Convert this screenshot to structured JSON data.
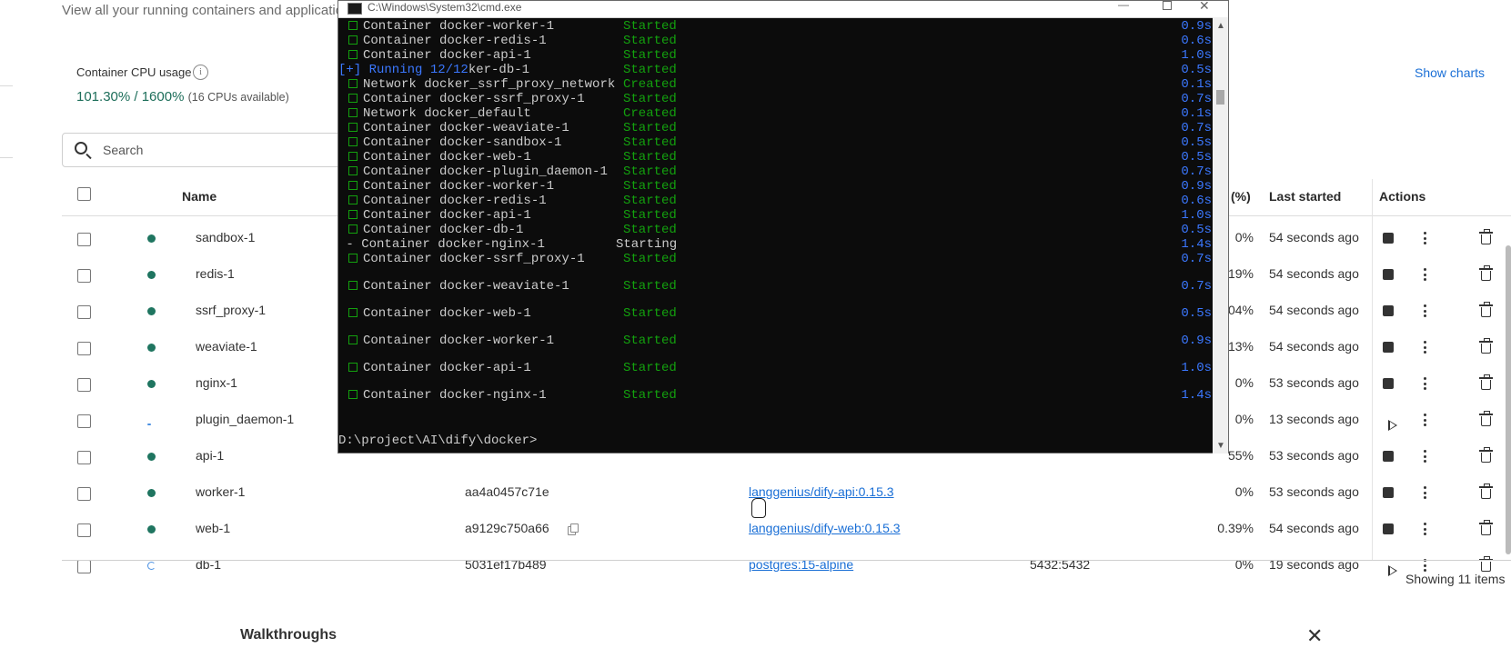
{
  "header": {
    "subtitle": "View all your running containers and applications",
    "cpu_label": "Container CPU usage",
    "info_icon": "info-icon",
    "cpu_value": "101.30% / 1600%",
    "cpu_available": "(16 CPUs available)",
    "show_charts": "Show charts"
  },
  "search": {
    "placeholder": "Search"
  },
  "table": {
    "col_name": "Name",
    "col_cpu": "(%)",
    "col_last_started": "Last started",
    "col_actions": "Actions",
    "rows": [
      {
        "name": "sandbox-1",
        "id": "",
        "image": "",
        "port": "",
        "cpu": "0%",
        "last": "54 seconds ago",
        "state": "running"
      },
      {
        "name": "redis-1",
        "id": "",
        "image": "",
        "port": "",
        "cpu": "19%",
        "last": "54 seconds ago",
        "state": "running"
      },
      {
        "name": "ssrf_proxy-1",
        "id": "",
        "image": "",
        "port": "",
        "cpu": "04%",
        "last": "54 seconds ago",
        "state": "running"
      },
      {
        "name": "weaviate-1",
        "id": "",
        "image": "",
        "port": "",
        "cpu": "13%",
        "last": "54 seconds ago",
        "state": "running"
      },
      {
        "name": "nginx-1",
        "id": "",
        "image": "",
        "port": "",
        "cpu": "0%",
        "last": "53 seconds ago",
        "state": "running"
      },
      {
        "name": "plugin_daemon-1",
        "id": "",
        "image": "",
        "port": "",
        "cpu": "0%",
        "last": "13 seconds ago",
        "state": "pending"
      },
      {
        "name": "api-1",
        "id": "",
        "image": "",
        "port": "",
        "cpu": "55%",
        "last": "53 seconds ago",
        "state": "running"
      },
      {
        "name": "worker-1",
        "id": "aa4a0457c71e",
        "image": "langgenius/dify-api:0.15.3",
        "port": "",
        "cpu": "0%",
        "last": "53 seconds ago",
        "state": "running"
      },
      {
        "name": "web-1",
        "id": "a9129c750a66",
        "image": "langgenius/dify-web:0.15.3",
        "port": "",
        "cpu": "0.39%",
        "last": "54 seconds ago",
        "state": "running"
      },
      {
        "name": "db-1",
        "id": "5031ef17b489",
        "image": "postgres:15-alpine",
        "port": "5432:5432",
        "cpu": "0%",
        "last": "19 seconds ago",
        "state": "starting"
      }
    ],
    "showing": "Showing 11 items"
  },
  "walkthroughs": {
    "title": "Walkthroughs",
    "close_icon": "close-icon",
    "close_glyph": "✕"
  },
  "cmd": {
    "title": "C:\\Windows\\System32\\cmd.exe",
    "prompt": "D:\\project\\AI\\dify\\docker>",
    "lines": [
      {
        "box": true,
        "text": "Container docker-worker-1",
        "status": "Started",
        "time": "0.9s"
      },
      {
        "box": true,
        "text": "Container docker-redis-1",
        "status": "Started",
        "time": "0.6s"
      },
      {
        "box": true,
        "text": "Container docker-api-1",
        "status": "Started",
        "time": "1.0s"
      },
      {
        "box": false,
        "prefix": "[+] Running 12/12",
        "text": "ker-db-1",
        "status": "Started",
        "time": "0.5s"
      },
      {
        "box": true,
        "text": "Network docker_ssrf_proxy_network",
        "status": "Created",
        "time": "0.1s"
      },
      {
        "box": true,
        "text": "Container docker-ssrf_proxy-1",
        "status": "Started",
        "time": "0.7s"
      },
      {
        "box": true,
        "text": "Network docker_default",
        "status": "Created",
        "time": "0.1s"
      },
      {
        "box": true,
        "text": "Container docker-weaviate-1",
        "status": "Started",
        "time": "0.7s"
      },
      {
        "box": true,
        "text": "Container docker-sandbox-1",
        "status": "Started",
        "time": "0.5s"
      },
      {
        "box": true,
        "text": "Container docker-web-1",
        "status": "Started",
        "time": "0.5s"
      },
      {
        "box": true,
        "text": "Container docker-plugin_daemon-1",
        "status": "Started",
        "time": "0.7s"
      },
      {
        "box": true,
        "text": "Container docker-worker-1",
        "status": "Started",
        "time": "0.9s"
      },
      {
        "box": true,
        "text": "Container docker-redis-1",
        "status": "Started",
        "time": "0.6s"
      },
      {
        "box": true,
        "text": "Container docker-api-1",
        "status": "Started",
        "time": "1.0s"
      },
      {
        "box": true,
        "text": "Container docker-db-1",
        "status": "Started",
        "time": "0.5s"
      },
      {
        "box": false,
        "prefix": " - ",
        "text": "Container docker-nginx-1",
        "status": "Starting",
        "time": "1.4s",
        "plain": true
      },
      {
        "box": true,
        "text": "Container docker-ssrf_proxy-1",
        "status": "Started",
        "time": "0.7s"
      },
      {
        "box": true,
        "text": "Container docker-weaviate-1",
        "status": "Started",
        "time": "0.7s"
      },
      {
        "box": true,
        "text": "Container docker-web-1",
        "status": "Started",
        "time": "0.5s"
      },
      {
        "box": true,
        "text": "Container docker-worker-1",
        "status": "Started",
        "time": "0.9s"
      },
      {
        "box": true,
        "text": "Container docker-api-1",
        "status": "Started",
        "time": "1.0s"
      },
      {
        "box": true,
        "text": "Container docker-nginx-1",
        "status": "Started",
        "time": "1.4s"
      }
    ]
  },
  "colors": {
    "accent": "#1a6fd6",
    "running": "#1f7560",
    "console_green": "#13a10e",
    "console_blue": "#3b78ff"
  }
}
